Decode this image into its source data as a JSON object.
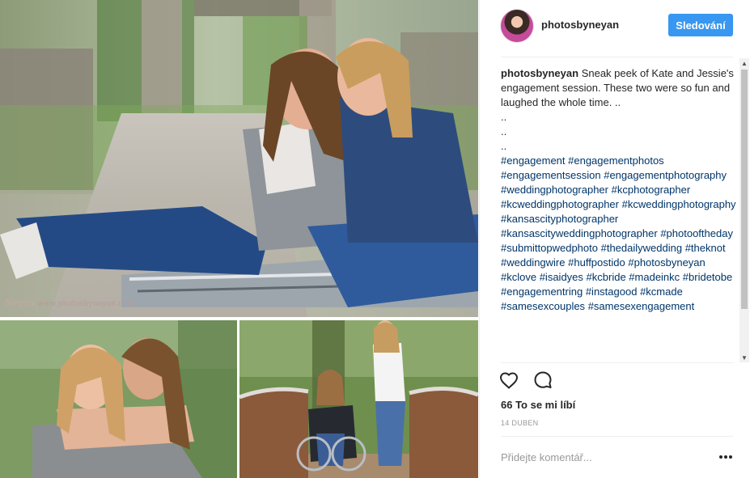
{
  "post": {
    "photos": [
      {
        "name": "photo-couple-sitting-on-bench"
      },
      {
        "name": "photo-couple-embracing"
      },
      {
        "name": "photo-couple-on-bridge-wheelchair"
      }
    ],
    "watermark": {
      "signature": "Neyan",
      "site": "www.photosbyneyan.com"
    }
  },
  "header": {
    "username": "photosbyneyan",
    "follow_label": "Sledování"
  },
  "caption": {
    "username": "photosbyneyan",
    "text": " Sneak peek of Kate and Jessie's engagement session. These two were so fun and laughed the whole time. ..\n..\n..\n..",
    "hashtags": [
      "#engagement",
      "#engagementphotos",
      "#engagementsession",
      "#engagementphotography",
      "#weddingphotographer",
      "#kcphotographer",
      "#kcweddingphotographer",
      "#kcweddingphotography",
      "#kansascityphotographer",
      "#kansascityweddingphotographer",
      "#photooftheday",
      "#submittopwedphoto",
      "#thedailywedding",
      "#theknot",
      "#weddingwire",
      "#huffpostido",
      "#photosbyneyan",
      "#kclove",
      "#isaidyes",
      "#kcbride",
      "#madeinkc",
      "#bridetobe",
      "#engagementring",
      "#instagood",
      "#kcmade",
      "#samesexcouples",
      "#samesexengagement"
    ]
  },
  "actions": {
    "like_icon": "heart-icon",
    "comment_icon": "comment-icon"
  },
  "likes": "66 To se mi líbí",
  "date": "14 DUBEN",
  "comment": {
    "placeholder": "Přidejte komentář..."
  },
  "colors": {
    "accent": "#3897f0",
    "hashtag": "#003569",
    "text": "#262626",
    "muted": "#999999"
  }
}
